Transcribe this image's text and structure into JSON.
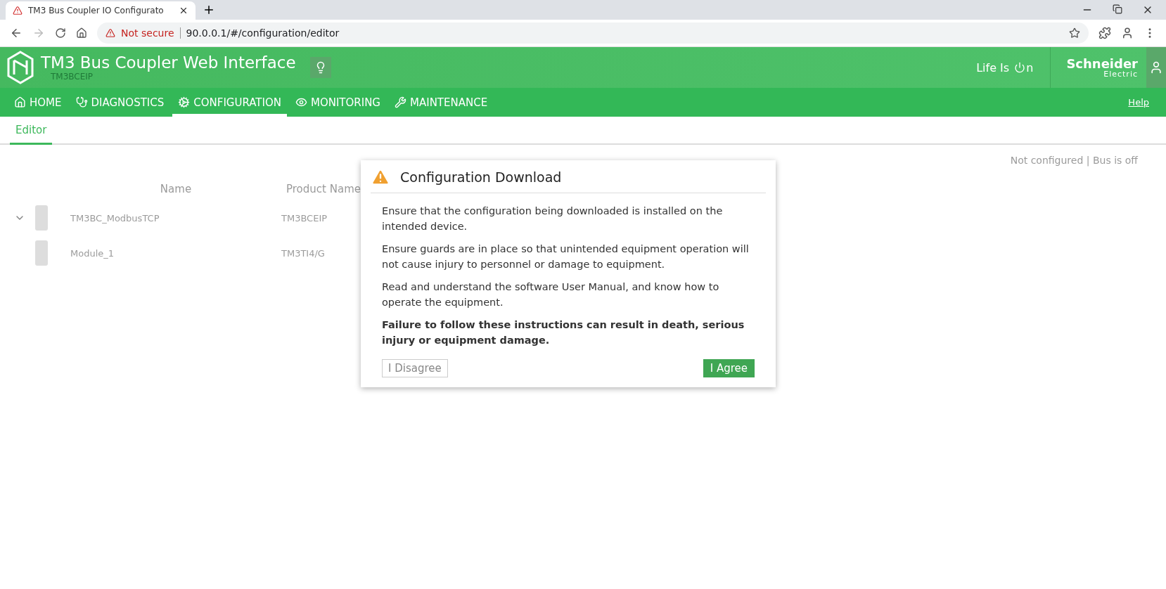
{
  "browser": {
    "tab_title": "TM3 Bus Coupler IO Configurato",
    "address_warning": "Not secure",
    "url": "90.0.0.1/#/configuration/editor"
  },
  "header": {
    "title": "TM3 Bus Coupler Web Interface",
    "subtitle": "TM3BCEIP",
    "tagline_start": "Life Is",
    "tagline_end": "n",
    "brand_top": "Schneider",
    "brand_bottom": "Electric"
  },
  "nav": {
    "items": [
      {
        "label": "HOME",
        "selected": false
      },
      {
        "label": "DIAGNOSTICS",
        "selected": false
      },
      {
        "label": "CONFIGURATION",
        "selected": true
      },
      {
        "label": "MONITORING",
        "selected": false
      },
      {
        "label": "MAINTENANCE",
        "selected": false
      }
    ],
    "help": "Help"
  },
  "subtabs": [
    {
      "label": "Editor",
      "selected": true
    }
  ],
  "background": {
    "device_status": "Not configured | Bus is off",
    "columns": [
      "Name",
      "Product Name"
    ],
    "rows": [
      {
        "name": "TM3BC_ModbusTCP",
        "product": "TM3BCEIP",
        "expanded": true
      },
      {
        "name": "Module_1",
        "product": "TM3TI4/G"
      }
    ]
  },
  "dialog": {
    "title": "Configuration Download",
    "paragraphs": [
      "Ensure that the configuration being downloaded is installed on the intended device.",
      "Ensure guards are in place so that unintended equipment operation will not cause injury to personnel or damage to equipment.",
      "Read and understand the software User Manual, and know how to operate the equipment."
    ],
    "warning": "Failure to follow these instructions can result in death, serious injury or equipment damage.",
    "disagree": "I Disagree",
    "agree": "I Agree"
  }
}
